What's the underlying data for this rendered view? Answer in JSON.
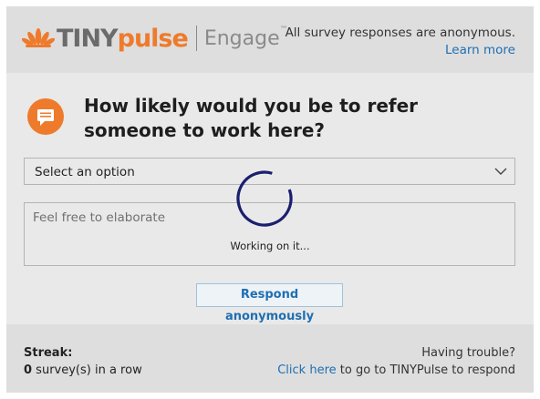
{
  "header": {
    "logo_tiny": "TINY",
    "logo_pulse": "pulse",
    "logo_engage": "Engage",
    "logo_tm": "™",
    "anonymous_text": "All survey responses are anonymous.",
    "learn_more": "Learn more"
  },
  "question": {
    "text": "How likely would you be to refer someone to work here?",
    "icon": "chat-bubble-icon"
  },
  "select": {
    "value": "Select an option",
    "icon": "chevron-down-icon"
  },
  "textarea": {
    "placeholder": "Feel free to elaborate"
  },
  "loading": {
    "text": "Working on it..."
  },
  "respond_button": "Respond anonymously",
  "footer": {
    "streak_label": "Streak:",
    "streak_count": "0",
    "streak_suffix": " survey(s) in a row",
    "trouble_label": "Having trouble?",
    "click_here": "Click here",
    "trouble_suffix": " to go to TINYPulse to respond"
  },
  "colors": {
    "brand_orange": "#ee7b2c",
    "link_blue": "#1f6fb2",
    "spinner_navy": "#1a1f6e"
  }
}
